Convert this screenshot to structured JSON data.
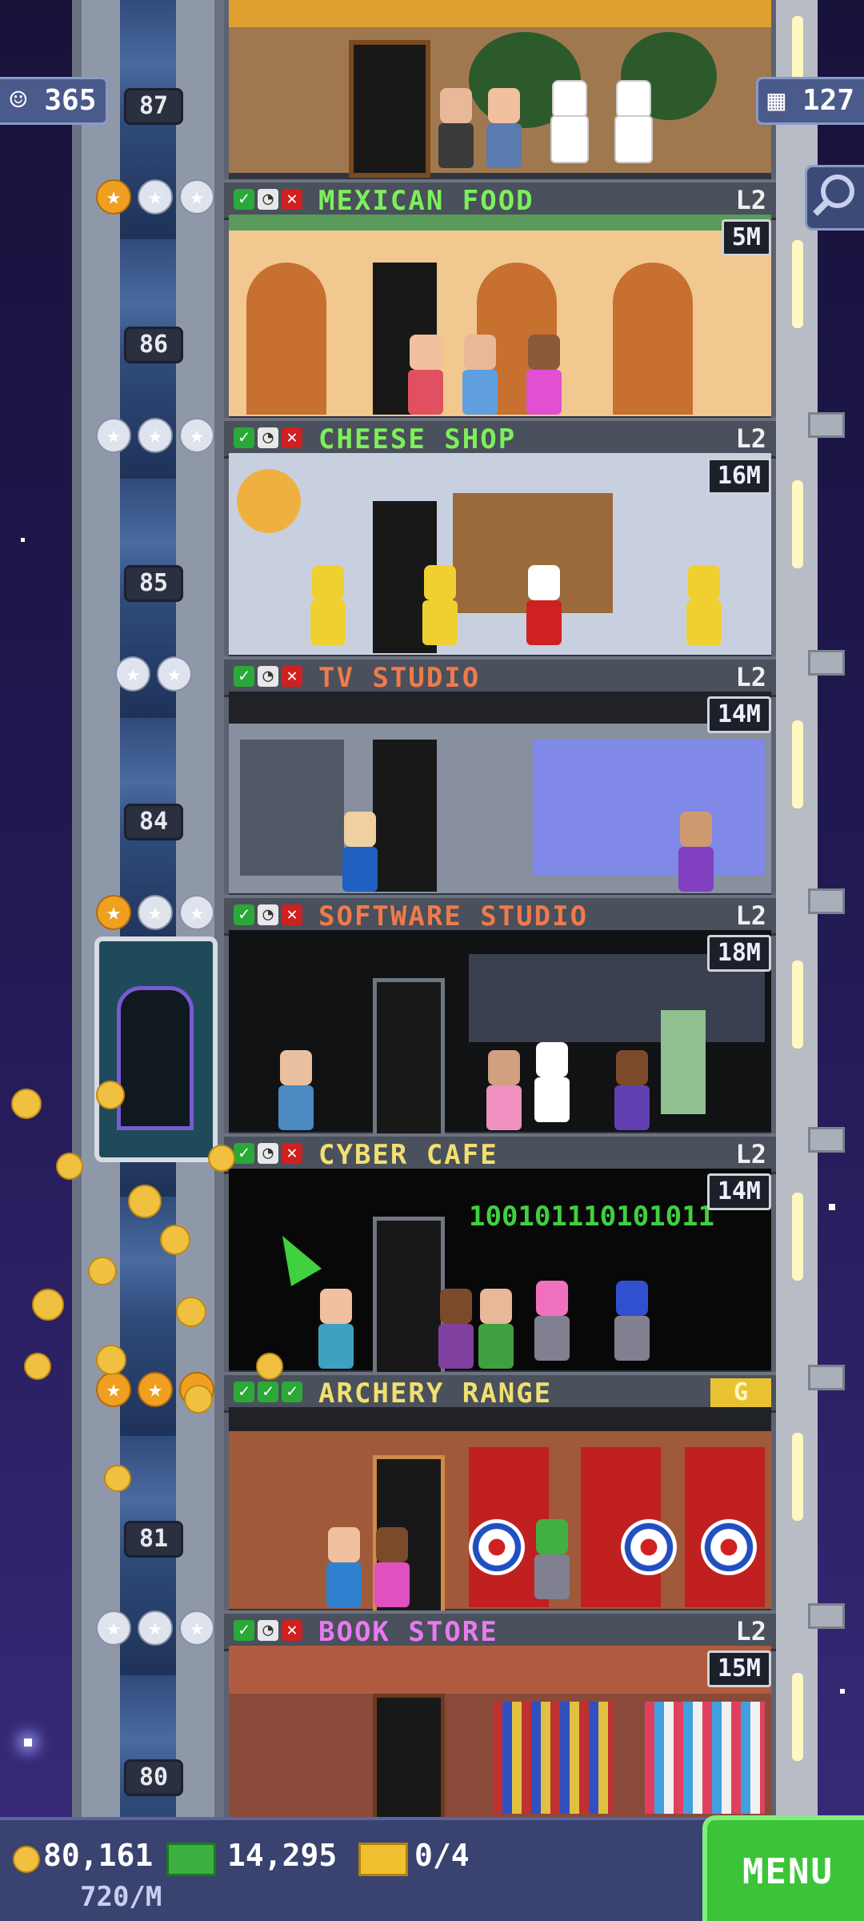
{
  "hud": {
    "population": "365",
    "floors": "127",
    "coins": "80,161",
    "bux": "14,295",
    "tickets": "0/4",
    "rate": "720/M",
    "menu_label": "MENU",
    "population_icon": "person-icon",
    "floors_icon": "building-icon",
    "search_icon": "magnifier-icon"
  },
  "shaft": {
    "floor_numbers": [
      "87",
      "86",
      "85",
      "84",
      "81",
      "80"
    ]
  },
  "floors": [
    {
      "name": "MEXICAN FOOD",
      "level": "L2",
      "money": "5M",
      "name_color": "#7cf05a",
      "stars": [
        "gold",
        "white",
        "white"
      ]
    },
    {
      "name": "CHEESE SHOP",
      "level": "L2",
      "money": "16M",
      "name_color": "#7cf05a",
      "stars": [
        "white",
        "white",
        "white"
      ]
    },
    {
      "name": "TV STUDIO",
      "level": "L2",
      "money": "14M",
      "name_color": "#f07a4a",
      "stars": [
        "white",
        "white"
      ]
    },
    {
      "name": "SOFTWARE STUDIO",
      "level": "L2",
      "money": "18M",
      "name_color": "#f07a4a",
      "stars": [
        "gold",
        "white",
        "white"
      ]
    },
    {
      "name": "CYBER CAFE",
      "level": "L2",
      "money": "14M",
      "name_color": "#f0e070",
      "stars": []
    },
    {
      "name": "ARCHERY RANGE",
      "level": "",
      "money": "",
      "gold_badge": "G",
      "name_color": "#f0e070",
      "stars": [
        "gold",
        "gold",
        "gold"
      ]
    },
    {
      "name": "BOOK STORE",
      "level": "L2",
      "money": "15M",
      "name_color": "#e87af0",
      "stars": [
        "white",
        "white",
        "white"
      ]
    }
  ],
  "scene_text": {
    "binary_sign": "100101110101011"
  },
  "colors": {
    "menu_green": "#3cc438",
    "hud_bar": "#3a4270",
    "sky": "#221a55"
  }
}
